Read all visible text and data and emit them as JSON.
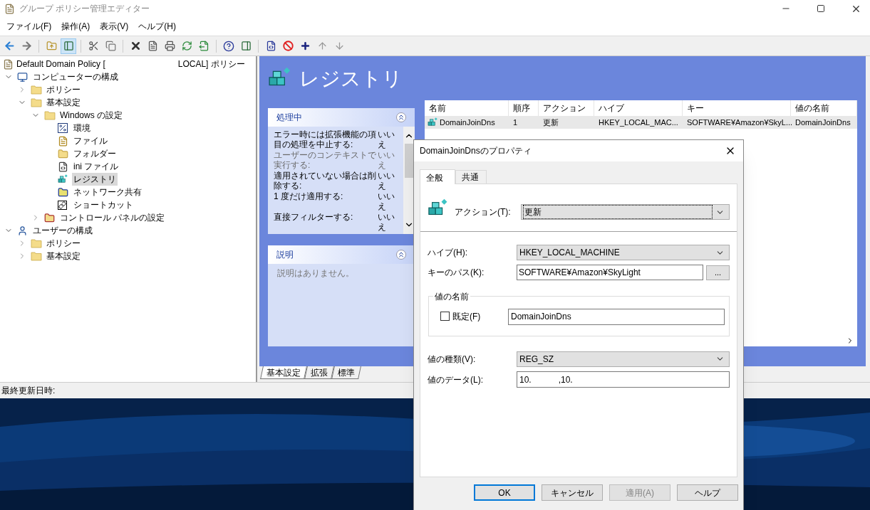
{
  "window": {
    "title": "グループ ポリシー管理エディター"
  },
  "menu": [
    "ファイル(F)",
    "操作(A)",
    "表示(V)",
    "ヘルプ(H)"
  ],
  "tree": {
    "root": "Default Domain Policy [",
    "root_suffix": "LOCAL] ポリシー",
    "items": [
      {
        "label": "コンピューターの構成",
        "kind": "computer",
        "expanded": true,
        "selected": false,
        "children": [
          {
            "label": "ポリシー",
            "kind": "folder",
            "expanded": false,
            "selected": false
          },
          {
            "label": "基本設定",
            "kind": "folder",
            "expanded": true,
            "selected": false,
            "children": [
              {
                "label": "Windows の設定",
                "kind": "folder",
                "expanded": true,
                "selected": false,
                "children": [
                  {
                    "label": "環境",
                    "kind": "env",
                    "selected": false
                  },
                  {
                    "label": "ファイル",
                    "kind": "file",
                    "selected": false
                  },
                  {
                    "label": "フォルダー",
                    "kind": "newfolder",
                    "selected": false
                  },
                  {
                    "label": "ini ファイル",
                    "kind": "ini",
                    "selected": false
                  },
                  {
                    "label": "レジストリ",
                    "kind": "registry",
                    "selected": true
                  },
                  {
                    "label": "ネットワーク共有",
                    "kind": "share",
                    "selected": false
                  },
                  {
                    "label": "ショートカット",
                    "kind": "shortcut",
                    "selected": false
                  }
                ]
              },
              {
                "label": "コントロール パネルの設定",
                "kind": "control",
                "expanded": false,
                "selected": false
              }
            ]
          }
        ]
      },
      {
        "label": "ユーザーの構成",
        "kind": "user",
        "expanded": true,
        "selected": false,
        "children": [
          {
            "label": "ポリシー",
            "kind": "folder",
            "expanded": false,
            "selected": false
          },
          {
            "label": "基本設定",
            "kind": "folder",
            "expanded": false,
            "selected": false
          }
        ]
      }
    ]
  },
  "pane": {
    "title": "レジストリ",
    "processing": {
      "title": "処理中",
      "rows": [
        {
          "label": "エラー時には拡張機能の項目の処理を中止する:",
          "value": "いいえ",
          "disabled": false
        },
        {
          "label": "ユーザーのコンテキストで実行する:",
          "value": "いいえ",
          "disabled": true
        },
        {
          "label": "適用されていない場合は削除する:",
          "value": "いいえ",
          "disabled": false
        },
        {
          "label": "1 度だけ適用する:",
          "value": "いいえ",
          "disabled": false
        },
        {
          "label": "直接フィルターする:",
          "value": "いいえ",
          "disabled": false
        }
      ]
    },
    "description": {
      "title": "説明",
      "text": "説明はありません。"
    },
    "columns": [
      "名前",
      "順序",
      "アクション",
      "ハイブ",
      "キー",
      "値の名前"
    ],
    "rows": [
      [
        "DomainJoinDns",
        "1",
        "更新",
        "HKEY_LOCAL_MAC...",
        "SOFTWARE¥Amazon¥SkyL...",
        "DomainJoinDns"
      ]
    ],
    "tabs": [
      {
        "label": "基本設定",
        "selected": true
      },
      {
        "label": "拡張",
        "selected": false
      },
      {
        "label": "標準",
        "selected": false
      }
    ]
  },
  "status_bar": {
    "label": "最終更新日時:"
  },
  "dialog": {
    "title": "DomainJoinDnsのプロパティ",
    "tabs": [
      {
        "label": "全般",
        "selected": true
      },
      {
        "label": "共通",
        "selected": false
      }
    ],
    "action": {
      "label": "アクション(T):",
      "value": "更新"
    },
    "hive": {
      "label": "ハイブ(H):",
      "value": "HKEY_LOCAL_MACHINE"
    },
    "key_path": {
      "label": "キーのパス(K):",
      "value": "SOFTWARE¥Amazon¥SkyLight",
      "browse": "..."
    },
    "value_name": {
      "group": "値の名前",
      "default_label": "既定(F)",
      "default_checked": false,
      "value": "DomainJoinDns"
    },
    "value_type": {
      "label": "値の種類(V):",
      "value": "REG_SZ"
    },
    "value_data": {
      "label": "値のデータ(L):",
      "parts": [
        "10.",
        ",10."
      ]
    },
    "buttons": [
      {
        "label": "OK",
        "disabled": false,
        "default": true
      },
      {
        "label": "キャンセル",
        "disabled": false,
        "default": false
      },
      {
        "label": "適用(A)",
        "disabled": true,
        "default": false
      },
      {
        "label": "ヘルプ",
        "disabled": false,
        "default": false
      }
    ]
  }
}
